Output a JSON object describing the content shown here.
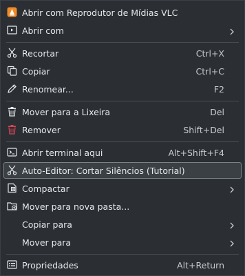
{
  "menu": {
    "items": [
      {
        "label": "Abrir com Reprodutor de Mídias VLC",
        "icon": "vlc-icon"
      },
      {
        "label": "Abrir com",
        "icon": "open-with-icon",
        "submenu": true
      },
      {
        "label": "Recortar",
        "shortcut": "Ctrl+X",
        "icon": "scissors-icon"
      },
      {
        "label": "Copiar",
        "shortcut": "Ctrl+C",
        "icon": "copy-icon"
      },
      {
        "label": "Renomear...",
        "shortcut": "F2",
        "icon": "pencil-icon"
      },
      {
        "label": "Mover para a Lixeira",
        "shortcut": "Del",
        "icon": "trash-icon"
      },
      {
        "label": "Remover",
        "shortcut": "Shift+Del",
        "icon": "delete-red-icon"
      },
      {
        "label": "Abrir terminal aqui",
        "shortcut": "Alt+Shift+F4",
        "icon": "terminal-icon"
      },
      {
        "label": "Auto-Editor: Cortar Silêncios (Tutorial)",
        "icon": "scissors-icon",
        "highlighted": true
      },
      {
        "label": "Compactar",
        "icon": "archive-icon",
        "submenu": true
      },
      {
        "label": "Mover para nova pasta...",
        "icon": "new-folder-icon"
      },
      {
        "label": "Copiar para",
        "submenu": true
      },
      {
        "label": "Mover para",
        "submenu": true
      },
      {
        "label": "Propriedades",
        "shortcut": "Alt+Return",
        "icon": "properties-icon"
      }
    ]
  },
  "colors": {
    "background": "#2b2f34",
    "text": "#e6e8ea",
    "highlight_border": "#7d8287",
    "delete_red": "#da4453",
    "vlc_orange": "#f08a24"
  }
}
